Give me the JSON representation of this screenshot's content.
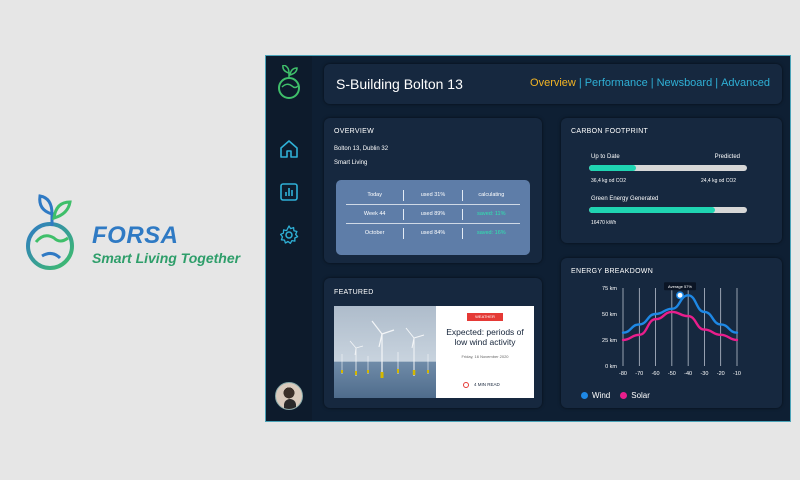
{
  "brand": {
    "name": "FORSA",
    "tagline": "Smart Living Together"
  },
  "colors": {
    "accent": "#2fb0d6",
    "active": "#f2b424",
    "green": "#1fd4b2",
    "wind": "#1e88e5",
    "solar": "#e91e8c",
    "panel": "#16283f"
  },
  "sidebar": {
    "items": [
      {
        "name": "home-icon"
      },
      {
        "name": "chart-icon"
      },
      {
        "name": "gear-icon"
      }
    ]
  },
  "header": {
    "title": "S-Building Bolton 13",
    "nav": [
      "Overview",
      "Performance",
      "Newsboard",
      "Advanced"
    ],
    "separator": "|",
    "active": "Overview"
  },
  "overview": {
    "title": "OVERVIEW",
    "address": "Bolton 13, Dublin 32",
    "type": "Smart Living",
    "rows": [
      [
        "Today",
        "used 31%",
        "calculating"
      ],
      [
        "Week 44",
        "used 89%",
        "saved: 11%"
      ],
      [
        "October",
        "used 84%",
        "saved: 16%"
      ]
    ]
  },
  "carbon": {
    "title": "CARBON FOOTPRINT",
    "left_label": "Up to Date",
    "right_label": "Predicted",
    "left_value": "36,4 kg od CO2",
    "right_value": "24,4 kg od CO2",
    "progress": 0.3,
    "green_label": "Green Energy Generated",
    "green_value": "16470 kWh",
    "green_progress": 0.8
  },
  "featured": {
    "title": "FEATURED",
    "badge": "WEATHER",
    "headline": "Expected: periods of low wind activity",
    "date": "Friday, 16 November 2020",
    "read_time": "4 MIN READ"
  },
  "energy": {
    "title": "ENERGY BREAKDOWN",
    "legend": [
      "Wind",
      "Solar"
    ]
  },
  "chart_data": {
    "type": "line",
    "x": [
      -80,
      -70,
      -60,
      -50,
      -40,
      -30,
      -20,
      -10
    ],
    "xticks": [
      "-80",
      "-70",
      "-60",
      "-50",
      "-40",
      "-30",
      "-20",
      "-10"
    ],
    "yticks": [
      "0 km",
      "25 km",
      "50 km",
      "75 km"
    ],
    "ylim": [
      0,
      75
    ],
    "xlim": [
      -80,
      -10
    ],
    "series": [
      {
        "name": "Wind",
        "color": "#1e88e5",
        "values": [
          32,
          40,
          50,
          55,
          68,
          52,
          40,
          32
        ]
      },
      {
        "name": "Solar",
        "color": "#e91e8c",
        "values": [
          25,
          30,
          45,
          52,
          48,
          35,
          30,
          25
        ]
      }
    ],
    "annotation": {
      "text": "Average 57%",
      "x": -45,
      "y": 68
    }
  }
}
